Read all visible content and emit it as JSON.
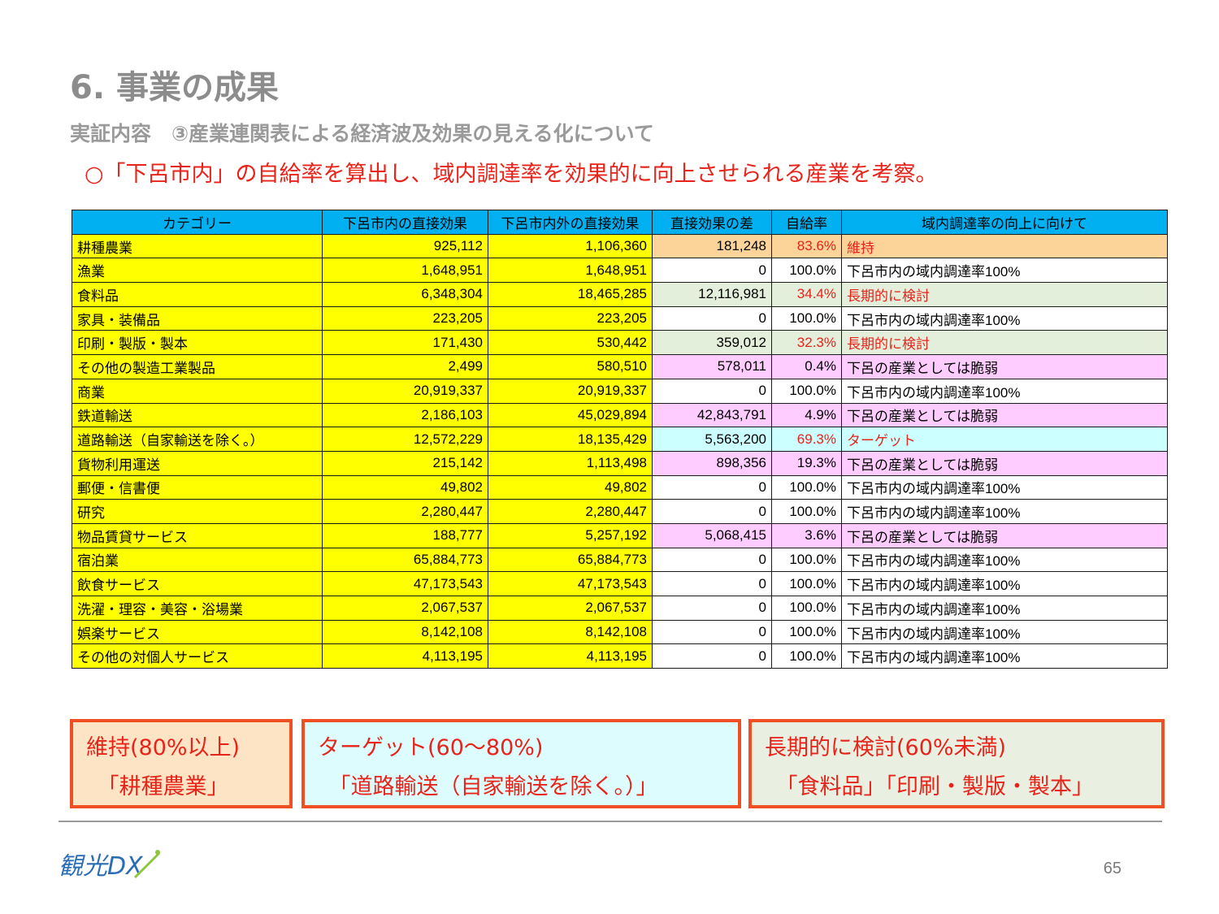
{
  "header": {
    "title": "6. 事業の成果",
    "subtitle": "実証内容　③産業連関表による経済波及効果の見える化について",
    "lead": "○「下呂市内」の自給率を算出し、域内調達率を効果的に向上させられる産業を考察。"
  },
  "table": {
    "columns": [
      "カテゴリー",
      "下呂市内の直接効果",
      "下呂市内外の直接効果",
      "直接効果の差",
      "自給率",
      "域内調達率の向上に向けて"
    ],
    "rows": [
      {
        "category": "耕種農業",
        "inside": "925,112",
        "total": "1,106,360",
        "diff": "181,248",
        "rate": "83.6%",
        "note": "維持",
        "highlight": "#fcd49a",
        "alert": true
      },
      {
        "category": "漁業",
        "inside": "1,648,951",
        "total": "1,648,951",
        "diff": "0",
        "rate": "100.0%",
        "note": "下呂市内の域内調達率100%",
        "highlight": "#ffffff",
        "alert": false
      },
      {
        "category": "食料品",
        "inside": "6,348,304",
        "total": "18,465,285",
        "diff": "12,116,981",
        "rate": "34.4%",
        "note": "長期的に検討",
        "highlight": "#e3eedb",
        "alert": true
      },
      {
        "category": "家具・装備品",
        "inside": "223,205",
        "total": "223,205",
        "diff": "0",
        "rate": "100.0%",
        "note": "下呂市内の域内調達率100%",
        "highlight": "#ffffff",
        "alert": false
      },
      {
        "category": "印刷・製版・製本",
        "inside": "171,430",
        "total": "530,442",
        "diff": "359,012",
        "rate": "32.3%",
        "note": "長期的に検討",
        "highlight": "#e3eedb",
        "alert": true
      },
      {
        "category": "その他の製造工業製品",
        "inside": "2,499",
        "total": "580,510",
        "diff": "578,011",
        "rate": "0.4%",
        "note": "下呂の産業としては脆弱",
        "highlight": "#ffccff",
        "alert": false
      },
      {
        "category": "商業",
        "inside": "20,919,337",
        "total": "20,919,337",
        "diff": "0",
        "rate": "100.0%",
        "note": "下呂市内の域内調達率100%",
        "highlight": "#ffffff",
        "alert": false
      },
      {
        "category": "鉄道輸送",
        "inside": "2,186,103",
        "total": "45,029,894",
        "diff": "42,843,791",
        "rate": "4.9%",
        "note": "下呂の産業としては脆弱",
        "highlight": "#ffccff",
        "alert": false
      },
      {
        "category": "道路輸送（自家輸送を除く。）",
        "inside": "12,572,229",
        "total": "18,135,429",
        "diff": "5,563,200",
        "rate": "69.3%",
        "note": "ターゲット",
        "highlight": "#ccffff",
        "alert": true
      },
      {
        "category": "貨物利用運送",
        "inside": "215,142",
        "total": "1,113,498",
        "diff": "898,356",
        "rate": "19.3%",
        "note": "下呂の産業としては脆弱",
        "highlight": "#ffccff",
        "alert": false
      },
      {
        "category": "郵便・信書便",
        "inside": "49,802",
        "total": "49,802",
        "diff": "0",
        "rate": "100.0%",
        "note": "下呂市内の域内調達率100%",
        "highlight": "#ffffff",
        "alert": false
      },
      {
        "category": "研究",
        "inside": "2,280,447",
        "total": "2,280,447",
        "diff": "0",
        "rate": "100.0%",
        "note": "下呂市内の域内調達率100%",
        "highlight": "#ffffff",
        "alert": false
      },
      {
        "category": "物品賃貸サービス",
        "inside": "188,777",
        "total": "5,257,192",
        "diff": "5,068,415",
        "rate": "3.6%",
        "note": "下呂の産業としては脆弱",
        "highlight": "#ffccff",
        "alert": false
      },
      {
        "category": "宿泊業",
        "inside": "65,884,773",
        "total": "65,884,773",
        "diff": "0",
        "rate": "100.0%",
        "note": "下呂市内の域内調達率100%",
        "highlight": "#ffffff",
        "alert": false
      },
      {
        "category": "飲食サービス",
        "inside": "47,173,543",
        "total": "47,173,543",
        "diff": "0",
        "rate": "100.0%",
        "note": "下呂市内の域内調達率100%",
        "highlight": "#ffffff",
        "alert": false
      },
      {
        "category": "洗濯・理容・美容・浴場業",
        "inside": "2,067,537",
        "total": "2,067,537",
        "diff": "0",
        "rate": "100.0%",
        "note": "下呂市内の域内調達率100%",
        "highlight": "#ffffff",
        "alert": false
      },
      {
        "category": "娯楽サービス",
        "inside": "8,142,108",
        "total": "8,142,108",
        "diff": "0",
        "rate": "100.0%",
        "note": "下呂市内の域内調達率100%",
        "highlight": "#ffffff",
        "alert": false
      },
      {
        "category": "その他の対個人サービス",
        "inside": "4,113,195",
        "total": "4,113,195",
        "diff": "0",
        "rate": "100.0%",
        "note": "下呂市内の域内調達率100%",
        "highlight": "#ffffff",
        "alert": false
      }
    ]
  },
  "boxes": [
    {
      "heading": "維持(80%以上)",
      "items": "　「耕種農業」"
    },
    {
      "heading": "ターゲット(60〜80%)",
      "items": "　「道路輸送（自家輸送を除く。）」"
    },
    {
      "heading": "長期的に検討(60%未満)",
      "items": "　「食料品」「印刷・製版・製本」"
    }
  ],
  "footer": {
    "logo_text": "観光DX",
    "page_number": "65"
  },
  "colors": {
    "accent_red": "#e8231a",
    "header_blue": "#00b0f0",
    "box_border": "#f04f23"
  }
}
